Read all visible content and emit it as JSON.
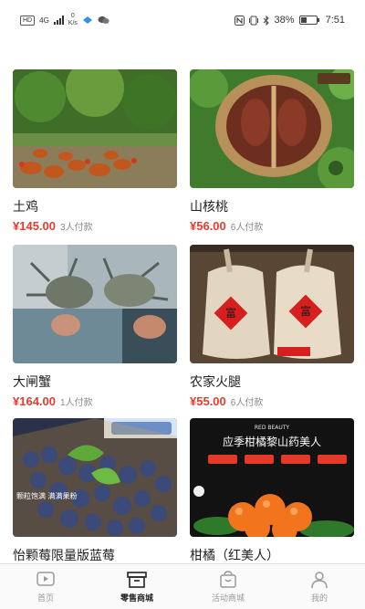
{
  "status_bar": {
    "left_badge": "HD",
    "net_type": "4G",
    "speed_value": "0",
    "speed_unit": "K/s",
    "battery": "38%",
    "time": "7:51"
  },
  "products": [
    {
      "name": "土鸡",
      "price": "¥145.00",
      "paid": "3人付款"
    },
    {
      "name": "山核桃",
      "price": "¥56.00",
      "paid": "6人付款"
    },
    {
      "name": "大闸蟹",
      "price": "¥164.00",
      "paid": "1人付款"
    },
    {
      "name": "农家火腿",
      "price": "¥55.00",
      "paid": "6人付款"
    },
    {
      "name": "怡颗莓限量版蓝莓",
      "price": "",
      "paid": ""
    },
    {
      "name": "柑橘（红美人）",
      "price": "",
      "paid": ""
    }
  ],
  "image_text": {
    "ham_seal": "富",
    "blueberry_banner": "颗粒饱满 满满果粉",
    "orange_brand": "RED BEAUTY",
    "orange_title": "应季柑橘黎山药美人"
  },
  "tabbar": {
    "items": [
      {
        "label": "首页",
        "icon": "play-icon"
      },
      {
        "label": "零售商城",
        "icon": "box-icon"
      },
      {
        "label": "活动商城",
        "icon": "bag-icon"
      },
      {
        "label": "我的",
        "icon": "person-icon"
      }
    ],
    "active_index": 1
  },
  "colors": {
    "price": "#e63c2f",
    "active_tab": "#222222",
    "inactive_tab": "#999999"
  }
}
